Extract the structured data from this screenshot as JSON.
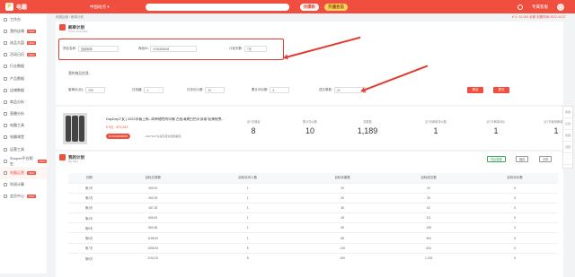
{
  "topbar": {
    "logo": "电霸",
    "site": "中国站点 ▾",
    "search_tag": "找爆款",
    "vip_tag": "开通会员",
    "right_links": [
      "通知",
      "专题访问",
      "帮助中心"
    ],
    "user": "专属客服"
  },
  "sidebar": {
    "items": [
      {
        "label": "工作台",
        "tag": ""
      },
      {
        "label": "我的店铺",
        "tag": "NEW"
      },
      {
        "label": "选品大盘",
        "tag": "NEW"
      },
      {
        "label": "活动日历",
        "tag": "NEW"
      },
      {
        "label": "行业数据",
        "tag": ""
      },
      {
        "label": "产品数据",
        "tag": ""
      },
      {
        "label": "店铺数据",
        "tag": ""
      },
      {
        "label": "商品分析",
        "tag": ""
      },
      {
        "label": "直播分析",
        "tag": ""
      },
      {
        "label": "电霸工具",
        "tag": ""
      },
      {
        "label": "电霸课堂",
        "tag": ""
      },
      {
        "label": "运营工具",
        "tag": ""
      },
      {
        "label": "Shopee平台爬虫",
        "tag": "NEW"
      },
      {
        "label": "电霸运营",
        "tag": "NEW"
      },
      {
        "label": "利润计算",
        "tag": ""
      },
      {
        "label": "会员中心",
        "tag": "NEW"
      }
    ]
  },
  "breadcrumb": {
    "path": "电霸运营 / 刷单计划",
    "right": "¥ 0 / 10,000 余额 到期时间:2022-04-07"
  },
  "plan_card": {
    "title": "刷单计划",
    "subtitle": "Curve Overview",
    "fields": {
      "name_label": "项目名称:",
      "name_value": "连续刷单",
      "product_id_label": "商品ID:",
      "product_id_value": "6196458638",
      "days_label": "计划天数:",
      "days_value": "7天"
    },
    "section_label": "我的商品信息:",
    "goods": {
      "price_label": "客单价(元):",
      "price_value": "299",
      "views_label": "日收藏:",
      "views_value": "1",
      "visitor_label": "日访问人数:",
      "visitor_value": "20",
      "total_label": "累计评价数:",
      "total_value": "5",
      "orders_label": "成交单数:",
      "orders_value": "20"
    },
    "btn_reset": "清空",
    "btn_submit": "提交"
  },
  "product": {
    "title": "DayDay少女 | 2022早春上新--简单随性的印象 百搭清爽白色半身裙 轻薄摇曳...",
    "price": "¥ 9元 - ¥73,263",
    "tag": "ID:6196458638",
    "tag2": "+DAYDAY氛感高层女装旗舰店",
    "stats": [
      {
        "label": "近7天销量",
        "value": "8"
      },
      {
        "label": "累计评价数",
        "value": "10"
      },
      {
        "label": "总数数",
        "value": "1,189"
      },
      {
        "label": "近7天刷单评价数",
        "value": "1"
      },
      {
        "label": "近7天刷单评价",
        "value": "1"
      },
      {
        "label": "近7天使用刷单评价",
        "value": "1"
      }
    ]
  },
  "my_plan": {
    "title": "我的计划",
    "subtitle": "My Plan",
    "buttons": [
      "导出数据",
      "保存",
      "分享"
    ],
    "columns": [
      "日期",
      "目标交易额",
      "目标访问人数",
      "目标访客数",
      "目标成交数",
      "目标评价数"
    ],
    "rows": [
      [
        "第1天",
        "269.00",
        "1",
        "20",
        "20",
        "5"
      ],
      [
        "第2天",
        "362.05",
        "1",
        "26",
        "35",
        "5"
      ],
      [
        "第3天",
        "487.28",
        "1",
        "36",
        "62",
        "5"
      ],
      [
        "第4天",
        "655.83",
        "1",
        "48",
        "111",
        "5"
      ],
      [
        "第5天",
        "882.68",
        "1",
        "65",
        "198",
        "5"
      ],
      [
        "第6天",
        "1188.00",
        "1",
        "88",
        "354",
        "5"
      ],
      [
        "第7天",
        "1598.93",
        "5",
        "118",
        "634",
        "5"
      ],
      [
        "第8天",
        "2152.00",
        "8",
        "160",
        "1,135",
        "5"
      ]
    ]
  },
  "floatbar": [
    "客服",
    "反馈",
    "收藏",
    "顶部",
    "›"
  ]
}
